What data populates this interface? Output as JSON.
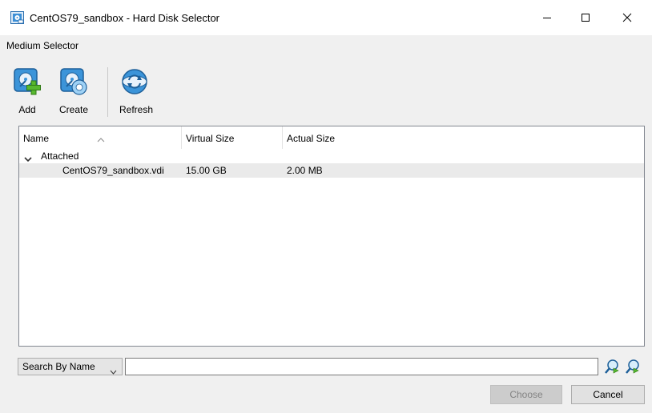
{
  "window": {
    "title": "CentOS79_sandbox - Hard Disk Selector",
    "app_icon": "virtualbox-disk-icon",
    "controls": [
      "minimize-icon",
      "maximize-icon",
      "close-icon"
    ]
  },
  "heading": "Medium Selector",
  "toolbar": {
    "add_label": "Add",
    "create_label": "Create",
    "refresh_label": "Refresh"
  },
  "table": {
    "columns": [
      "Name",
      "Virtual Size",
      "Actual Size"
    ],
    "sort_indicator": "chevron-up-icon",
    "groups": [
      {
        "label": "Attached",
        "expanded": true,
        "rows": [
          {
            "name": "CentOS79_sandbox.vdi",
            "virtual_size": "15.00 GB",
            "actual_size": "2.00 MB"
          }
        ]
      }
    ]
  },
  "search": {
    "mode": "Search By Name",
    "value": "",
    "placeholder": ""
  },
  "buttons": {
    "choose": "Choose",
    "cancel": "Cancel"
  },
  "colors": {
    "selected_row": "#eaeaea",
    "icon_blue": "#2c8ccf",
    "icon_green": "#4caf2a"
  }
}
